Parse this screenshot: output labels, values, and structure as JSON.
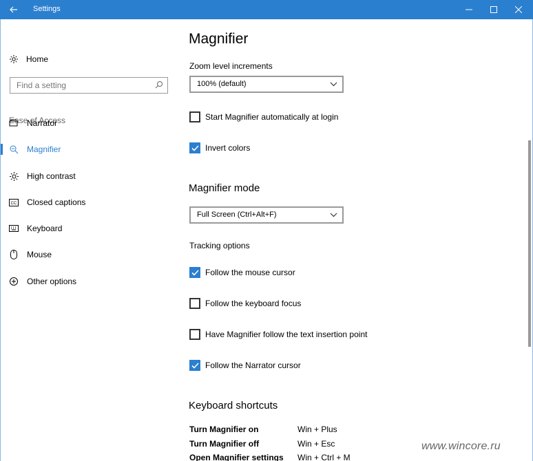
{
  "window": {
    "title": "Settings"
  },
  "sidebar": {
    "home_label": "Home",
    "search_placeholder": "Find a setting",
    "section_label": "Ease of Access",
    "items": [
      {
        "label": "Narrator",
        "icon": "narrator-icon"
      },
      {
        "label": "Magnifier",
        "icon": "magnifier-icon",
        "active": true
      },
      {
        "label": "High contrast",
        "icon": "brightness-icon"
      },
      {
        "label": "Closed captions",
        "icon": "closed-captions-icon"
      },
      {
        "label": "Keyboard",
        "icon": "keyboard-icon"
      },
      {
        "label": "Mouse",
        "icon": "mouse-icon"
      },
      {
        "label": "Other options",
        "icon": "other-options-icon"
      }
    ]
  },
  "main": {
    "title": "Magnifier",
    "zoom_label": "Zoom level increments",
    "zoom_value": "100% (default)",
    "start_auto": {
      "label": "Start Magnifier automatically at login",
      "checked": false
    },
    "invert_colors": {
      "label": "Invert colors",
      "checked": true
    },
    "mode_heading": "Magnifier mode",
    "mode_value": "Full Screen (Ctrl+Alt+F)",
    "tracking_label": "Tracking options",
    "tracking": [
      {
        "label": "Follow the mouse cursor",
        "checked": true
      },
      {
        "label": "Follow the keyboard focus",
        "checked": false
      },
      {
        "label": "Have Magnifier follow the text insertion point",
        "checked": false
      },
      {
        "label": "Follow the Narrator cursor",
        "checked": true
      }
    ],
    "shortcuts_heading": "Keyboard shortcuts",
    "shortcuts": [
      {
        "name": "Turn Magnifier on",
        "keys": "Win + Plus"
      },
      {
        "name": "Turn Magnifier off",
        "keys": "Win + Esc"
      },
      {
        "name": "Open Magnifier settings",
        "keys": "Win + Ctrl + M"
      }
    ]
  },
  "watermark": "www.wincore.ru",
  "colors": {
    "accent": "#2b7fcf",
    "titlebar": "#2b7fcf"
  }
}
